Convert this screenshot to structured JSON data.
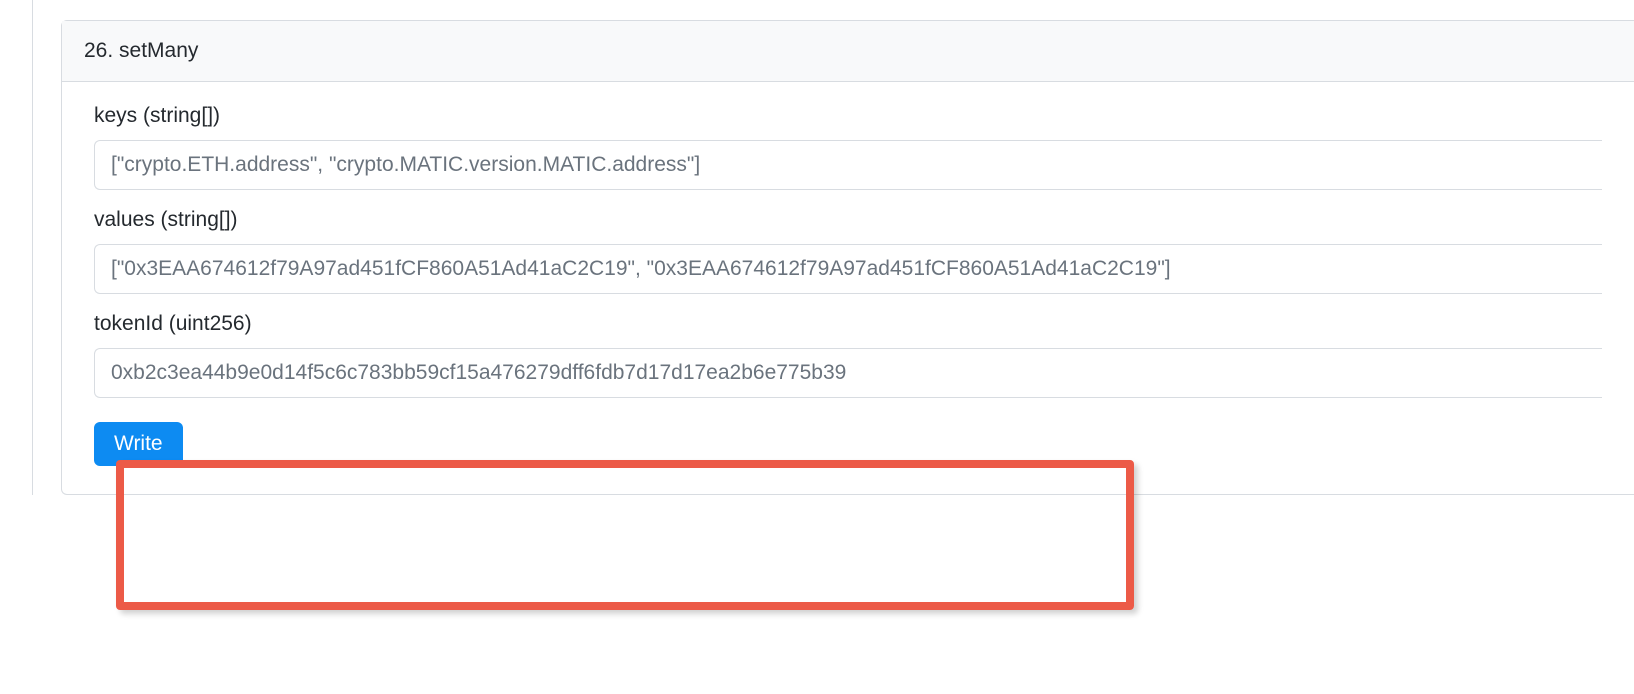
{
  "panel": {
    "header": "26. setMany",
    "fields": {
      "keys": {
        "label": "keys (string[])",
        "value": "[\"crypto.ETH.address\", \"crypto.MATIC.version.MATIC.address\"]"
      },
      "values": {
        "label": "values (string[])",
        "value": "[\"0x3EAA674612f79A97ad451fCF860A51Ad41aC2C19\", \"0x3EAA674612f79A97ad451fCF860A51Ad41aC2C19\"]"
      },
      "tokenId": {
        "label": "tokenId (uint256)",
        "value": "0xb2c3ea44b9e0d14f5c6c783bb59cf15a476279dff6fdb7d17d17ea2b6e775b39"
      }
    },
    "writeButton": "Write"
  }
}
